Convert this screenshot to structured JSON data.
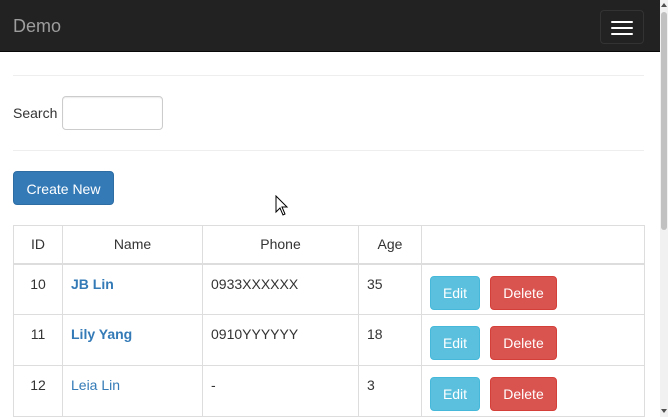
{
  "navbar": {
    "brand": "Demo",
    "toggle_icon": "hamburger-icon"
  },
  "search": {
    "label": "Search",
    "value": "",
    "placeholder": ""
  },
  "actions": {
    "create_label": "Create New"
  },
  "table": {
    "columns": [
      "ID",
      "Name",
      "Phone",
      "Age",
      ""
    ],
    "rows": [
      {
        "id": "10",
        "name": "JB Lin",
        "phone": "0933XXXXXX",
        "age": "35",
        "edit": "Edit",
        "delete": "Delete"
      },
      {
        "id": "11",
        "name": "Lily Yang",
        "phone": "0910YYYYYY",
        "age": "18",
        "edit": "Edit",
        "delete": "Delete"
      },
      {
        "id": "12",
        "name": "Leia Lin",
        "phone": "-",
        "age": "3",
        "edit": "Edit",
        "delete": "Delete"
      }
    ]
  },
  "colors": {
    "navbar_bg": "#222222",
    "brand_text": "#9d9d9d",
    "primary": "#337ab7",
    "info": "#5bc0de",
    "danger": "#d9534f"
  }
}
